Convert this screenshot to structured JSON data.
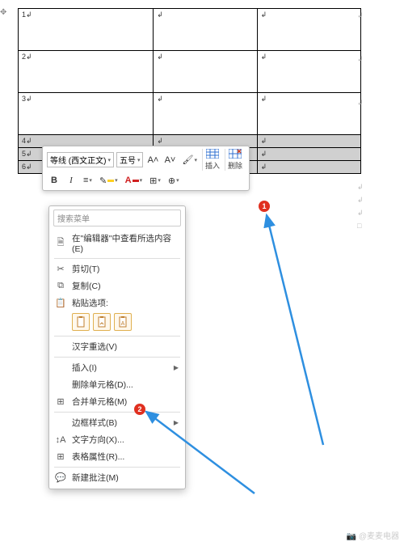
{
  "table": {
    "rows": [
      {
        "cells": [
          "1↲",
          "↲",
          "↲"
        ],
        "selected": false
      },
      {
        "cells": [
          "2↲",
          "↲",
          "↲"
        ],
        "selected": false
      },
      {
        "cells": [
          "3↲",
          "↲",
          "↲"
        ],
        "selected": false
      },
      {
        "cells": [
          "4↲",
          "↲",
          "↲"
        ],
        "selected": true
      },
      {
        "cells": [
          "5↲",
          "↲",
          "↲"
        ],
        "selected": true
      },
      {
        "cells": [
          "6↲",
          "↲",
          "↲"
        ],
        "selected": true
      }
    ]
  },
  "mini_toolbar": {
    "font_family": "等线 (西文正文)",
    "font_size": "五号",
    "grow": "A˄",
    "shrink": "A˅",
    "bold": "B",
    "italic": "I",
    "insert_label": "插入",
    "delete_label": "删除"
  },
  "ctx": {
    "search_placeholder": "搜索菜单",
    "lookup": "在\"编辑器\"中查看所选内容(E)",
    "cut": "剪切(T)",
    "copy": "复制(C)",
    "paste_label": "粘贴选项:",
    "reconvert": "汉字重选(V)",
    "insert": "插入(I)",
    "delete_cells": "删除单元格(D)...",
    "merge_cells": "合并单元格(M)",
    "border_styles": "边框样式(B)",
    "text_direction": "文字方向(X)...",
    "table_props": "表格属性(R)...",
    "new_comment": "新建批注(M)"
  },
  "badges": {
    "b1": "1",
    "b2": "2"
  },
  "watermark": "@麦麦电器"
}
